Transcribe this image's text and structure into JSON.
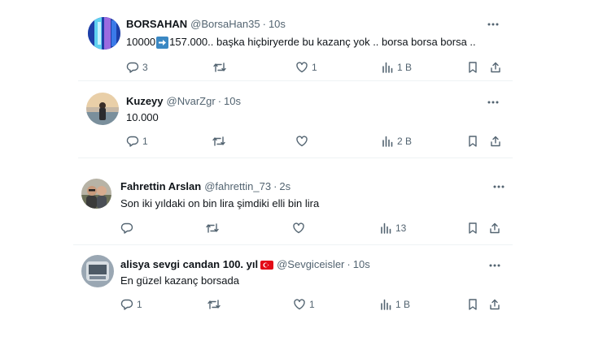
{
  "tweets": [
    {
      "name": "BORSAHAN",
      "handle": "@BorsaHan35",
      "time": "10s",
      "text_before": "10000",
      "arrow_icon": "right-arrow-emoji-icon",
      "text_after": "157.000.. başka hiçbiryerde bu kazanç yok .. borsa  borsa borsa ..",
      "replies": "3",
      "retweets": "",
      "likes": "1",
      "views": "1 B"
    },
    {
      "name": "Kuzeyy",
      "handle": "@NvarZgr",
      "time": "10s",
      "text": "10.000",
      "replies": "1",
      "retweets": "",
      "likes": "",
      "views": "2 B"
    },
    {
      "name": "Fahrettin Arslan",
      "handle": "@fahrettin_73",
      "time": "2s",
      "text": "Son iki yıldaki on bin lira şimdiki elli bin lira",
      "replies": "",
      "retweets": "",
      "likes": "",
      "views": "13"
    },
    {
      "name": "alisya sevgi candan 100. yıl",
      "flag_icon": "turkey-flag-icon",
      "handle": "@Sevgiceisler",
      "time": "10s",
      "text": "En güzel kazanç borsada",
      "replies": "1",
      "retweets": "",
      "likes": "1",
      "views": "1 B"
    }
  ],
  "dot": "·",
  "colors": {
    "text": "#0f1419",
    "muted": "#536471",
    "separator": "#eff3f4",
    "arrow_emoji": "#3b88c3",
    "flag": "#e30a17"
  }
}
